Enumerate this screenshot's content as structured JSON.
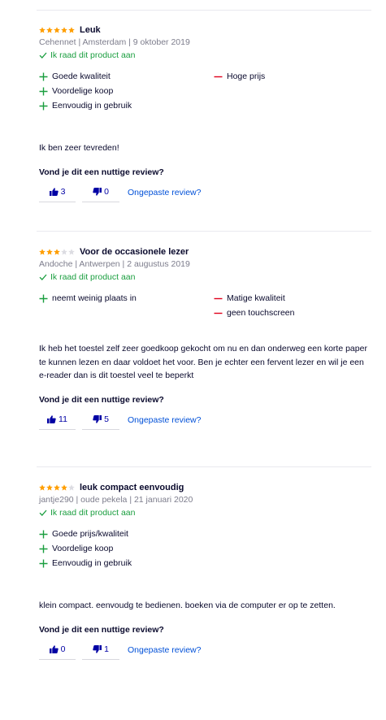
{
  "colors": {
    "star_filled": "#ff9e00",
    "star_empty": "#dcdce2",
    "pro": "#1a9e3f",
    "con": "#e0001b",
    "link": "#0050d8",
    "vote": "#0000a4"
  },
  "reviews": [
    {
      "rating": 5,
      "title": "Leuk",
      "meta": "Cehennet | Amsterdam | 9 oktober 2019",
      "recommend": "Ik raad dit product aan",
      "pros": [
        "Goede kwaliteit",
        "Voordelige koop",
        "Eenvoudig in gebruik"
      ],
      "cons": [
        "Hoge prijs"
      ],
      "body": "Ik ben zeer tevreden!",
      "helpful_question": "Vond je dit een nuttige review?",
      "up": "3",
      "down": "0",
      "report": "Ongepaste review?"
    },
    {
      "rating": 3,
      "title": "Voor de occasionele lezer",
      "meta": "Andoche | Antwerpen | 2 augustus 2019",
      "recommend": "Ik raad dit product aan",
      "pros": [
        "neemt weinig plaats in"
      ],
      "cons": [
        "Matige kwaliteit",
        "geen touchscreen"
      ],
      "body": "Ik heb het toestel zelf zeer goedkoop gekocht om nu en dan onderweg een korte paper te kunnen lezen en daar voldoet het voor. Ben je echter een fervent lezer en wil je een e-reader dan is dit toestel veel te beperkt",
      "helpful_question": "Vond je dit een nuttige review?",
      "up": "11",
      "down": "5",
      "report": "Ongepaste review?"
    },
    {
      "rating": 4,
      "title": "leuk compact eenvoudig",
      "meta": "jantje290 | oude pekela | 21 januari 2020",
      "recommend": "Ik raad dit product aan",
      "pros": [
        "Goede prijs/kwaliteit",
        "Voordelige koop",
        "Eenvoudig in gebruik"
      ],
      "cons": [],
      "body": "klein compact. eenvoudg te bedienen. boeken via de computer er op te zetten.",
      "helpful_question": "Vond je dit een nuttige review?",
      "up": "0",
      "down": "1",
      "report": "Ongepaste review?"
    }
  ]
}
